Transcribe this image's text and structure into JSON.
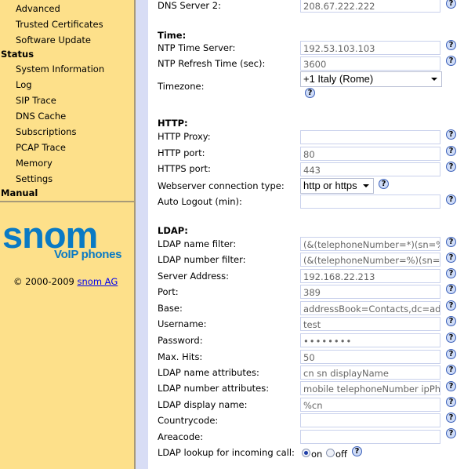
{
  "sidebar": {
    "items": [
      {
        "label": "Advanced",
        "type": "item"
      },
      {
        "label": "Trusted Certificates",
        "type": "item"
      },
      {
        "label": "Software Update",
        "type": "item"
      },
      {
        "label": "Status",
        "type": "header"
      },
      {
        "label": "System Information",
        "type": "item"
      },
      {
        "label": "Log",
        "type": "item"
      },
      {
        "label": "SIP Trace",
        "type": "item"
      },
      {
        "label": "DNS Cache",
        "type": "item"
      },
      {
        "label": "Subscriptions",
        "type": "item"
      },
      {
        "label": "PCAP Trace",
        "type": "item"
      },
      {
        "label": "Memory",
        "type": "item"
      },
      {
        "label": "Settings",
        "type": "item"
      },
      {
        "label": "Manual",
        "type": "header"
      }
    ],
    "logo": {
      "brand": "snom",
      "tagline": "VoIP phones"
    },
    "copyright": {
      "text": "© 2000-2009 ",
      "link": "snom AG"
    }
  },
  "form": {
    "dns_server_2": {
      "label": "DNS Server 2:",
      "value": "208.67.222.222"
    },
    "time": {
      "title": "Time:",
      "ntp_server": {
        "label": "NTP Time Server:",
        "value": "192.53.103.103"
      },
      "ntp_refresh": {
        "label": "NTP Refresh Time (sec):",
        "value": "3600"
      },
      "timezone": {
        "label": "Timezone:",
        "value": "+1 Italy (Rome)"
      }
    },
    "http": {
      "title": "HTTP:",
      "proxy": {
        "label": "HTTP Proxy:",
        "value": ""
      },
      "port": {
        "label": "HTTP port:",
        "value": "80"
      },
      "https_port": {
        "label": "HTTPS port:",
        "value": "443"
      },
      "conn_type": {
        "label": "Webserver connection type:",
        "value": "http or https"
      },
      "auto_logout": {
        "label": "Auto Logout (min):",
        "value": ""
      }
    },
    "ldap": {
      "title": "LDAP:",
      "name_filter": {
        "label": "LDAP name filter:",
        "value": "(&(telephoneNumber=*)(sn=%"
      },
      "number_filter": {
        "label": "LDAP number filter:",
        "value": "(&(telephoneNumber=%)(sn=*"
      },
      "server": {
        "label": "Server Address:",
        "value": "192.168.22.213"
      },
      "port": {
        "label": "Port:",
        "value": "389"
      },
      "base": {
        "label": "Base:",
        "value": "addressBook=Contacts,dc=add"
      },
      "username": {
        "label": "Username:",
        "value": "test"
      },
      "password": {
        "label": "Password:",
        "value": "••••••••"
      },
      "max_hits": {
        "label": "Max. Hits:",
        "value": "50"
      },
      "name_attrs": {
        "label": "LDAP name attributes:",
        "value": "cn sn displayName"
      },
      "number_attrs": {
        "label": "LDAP number attributes:",
        "value": "mobile telephoneNumber ipPho"
      },
      "display_name": {
        "label": "LDAP display name:",
        "value": "%cn"
      },
      "countrycode": {
        "label": "Countrycode:",
        "value": ""
      },
      "areacode": {
        "label": "Areacode:",
        "value": ""
      },
      "incoming_lookup": {
        "label": "LDAP lookup for incoming call:",
        "on_label": "on",
        "off_label": "off",
        "selected": "on"
      }
    },
    "help_glyph": "?"
  }
}
